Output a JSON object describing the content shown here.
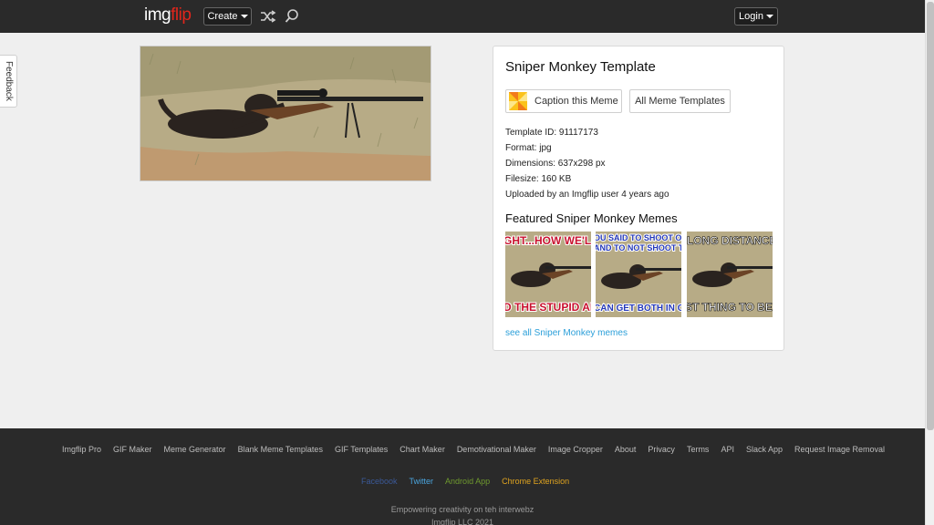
{
  "header": {
    "logo_img": "img",
    "logo_flip": "flip",
    "create_label": "Create",
    "login_label": "Login",
    "icons": [
      "shuffle-icon",
      "search-icon",
      "chevron-down-icon"
    ]
  },
  "feedback": {
    "label": "Feedback"
  },
  "template": {
    "title": "Sniper Monkey Template",
    "caption_button": "Caption this Meme",
    "all_templates_button": "All Meme Templates",
    "meta": [
      "Template ID: 91117173",
      "Format: jpg",
      "Dimensions: 637x298 px",
      "Filesize: 160 KB",
      "Uploaded by an Imgflip user 4 years ago"
    ],
    "featured_title": "Featured Sniper Monkey Memes",
    "thumbs": [
      {
        "top": "GHT...HOW WE'L",
        "bottom": "D THE STUPID AN"
      },
      {
        "top": "OU SAID TO SHOOT O",
        "top2": "AND TO NOT SHOOT TH",
        "bottom": "CAN GET BOTH IN ON"
      },
      {
        "top": "LONG DISTANCE",
        "bottom": "ST THING TO BEIN"
      }
    ],
    "see_all": "see all Sniper Monkey memes"
  },
  "footer": {
    "links": [
      "Imgflip Pro",
      "GIF Maker",
      "Meme Generator",
      "Blank Meme Templates",
      "GIF Templates",
      "Chart Maker",
      "Demotivational Maker",
      "Image Cropper",
      "About",
      "Privacy",
      "Terms",
      "API",
      "Slack App",
      "Request Image Removal"
    ],
    "social": [
      {
        "label": "Facebook",
        "color": "#3b5998"
      },
      {
        "label": "Twitter",
        "color": "#4aa4dd"
      },
      {
        "label": "Android App",
        "color": "#6f9a2e"
      },
      {
        "label": "Chrome Extension",
        "color": "#e0a41f"
      }
    ],
    "tagline": "Empowering creativity on teh interwebz",
    "copyright": "Imgflip LLC 2021"
  },
  "colors": {
    "header_bg": "#2a2a2a",
    "logo_accent": "#e1261c",
    "link_blue": "#2b9fd9",
    "page_bg": "#efefef"
  }
}
